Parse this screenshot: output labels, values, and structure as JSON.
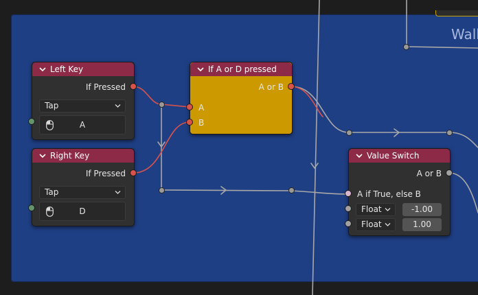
{
  "frame": {
    "label": "Wall"
  },
  "nodes": {
    "left_key": {
      "title": "Left Key",
      "output": "If Pressed",
      "mode": "Tap",
      "key": "A"
    },
    "right_key": {
      "title": "Right Key",
      "output": "If Pressed",
      "mode": "Tap",
      "key": "D"
    },
    "or_node": {
      "title": "If A or D pressed",
      "output": "A or B",
      "input_a": "A",
      "input_b": "B",
      "color": "#cc9a00"
    },
    "value_switch": {
      "title": "Value Switch",
      "output": "A or B",
      "condition": "A if True, else B",
      "type_a": "Float",
      "value_a": "-1.00",
      "type_b": "Float",
      "value_b": "1.00"
    }
  },
  "colors": {
    "frame": "#1f3f85",
    "header": "#8c2a47",
    "bool_socket": "#d9534a",
    "wire_bool": "#d9534a",
    "wire_generic": "#a8a8a8"
  }
}
